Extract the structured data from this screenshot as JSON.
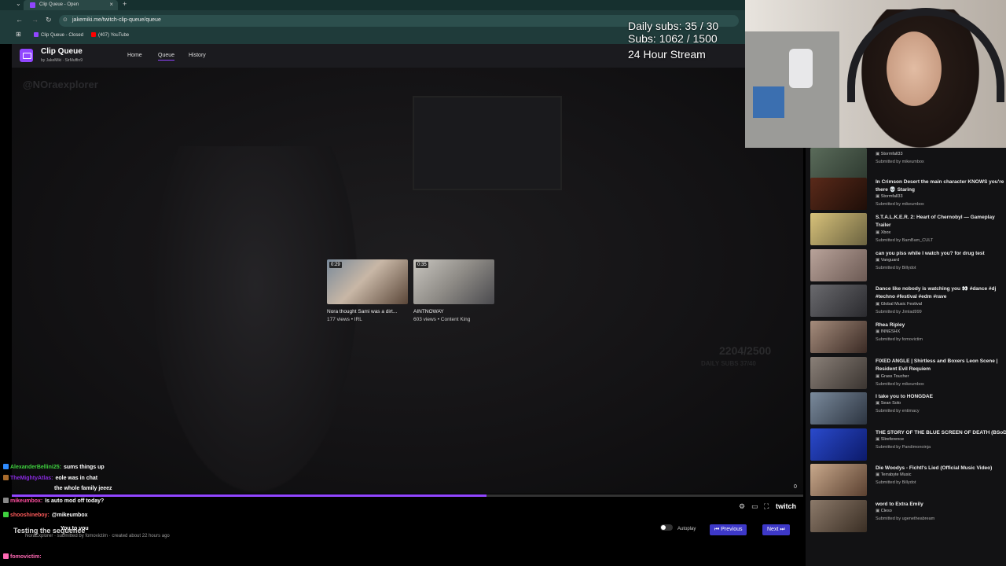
{
  "browser": {
    "tab_title": "Clip Queue - Open",
    "url": "jakemiki.me/twitch-clip-queue/queue",
    "bookmarks": [
      "Clip Queue - Closed",
      "(407) YouTube"
    ]
  },
  "app": {
    "title": "Clip Queue",
    "by": "by JakeMiki · SirMuffin9",
    "nav": [
      "Home",
      "Queue",
      "History"
    ],
    "active_nav": "Queue"
  },
  "overlay": {
    "daily_subs": "Daily subs: 35 / 30",
    "subs": "Subs: 1062 / 1500",
    "stream": "24 Hour Stream"
  },
  "player": {
    "watermark": "@NOraexplorer",
    "ghost_count": "2204/2500",
    "ghost_sub": "DAILY SUBS 37/40",
    "progress_fraction": 0.6,
    "time_label": "0",
    "brand": "twitch",
    "suggestions": [
      {
        "duration": "0:29",
        "title": "Nora thought Sami was a dirt...",
        "meta": "177 views • IRL"
      },
      {
        "duration": "0:35",
        "title": "AINTNOWAY",
        "meta": "603 views • Content King"
      }
    ]
  },
  "current_clip": {
    "title": "Testing the sequence",
    "meta": "NoraExplorer · submitted by fomovictim · created about 22 hours ago"
  },
  "controls": {
    "autoplay_label": "Autoplay",
    "previous_label": "Previous",
    "next_label": "Next"
  },
  "chat": [
    {
      "user": "AlexanderBellini25:",
      "msg": "sums things up",
      "color": "#3fd13f"
    },
    {
      "user": "TheMightyAtlas:",
      "msg": "eole was in chat",
      "color": "#8a2be2"
    },
    {
      "user": "",
      "msg": "the whole family jeeez",
      "color": "#1e90ff"
    },
    {
      "user": "mikeumbox:",
      "msg": "Is auto mod off today?",
      "color": "#ff4fa0"
    },
    {
      "user": "shooshineboy:",
      "msg": "@mikeumbox",
      "color": "#ff5a5a"
    },
    {
      "user": "",
      "msg": "You to you",
      "color": "#aaaaaa"
    },
    {
      "user": "fomovictim:",
      "msg": "",
      "color": "#ff69b4"
    }
  ],
  "queue": [
    {
      "title": "",
      "channel": "Stormfall33",
      "submitted": "Submitted by mikeumbox"
    },
    {
      "title": "In Crimson Desert the main character KNOWS you're there 💀 Staring",
      "channel": "Stormfall33",
      "submitted": "Submitted by mikeumbox"
    },
    {
      "title": "S.T.A.L.K.E.R. 2: Heart of Chernobyl — Gameplay Trailer",
      "channel": "Xbox",
      "submitted": "Submitted by BamBam_CULT"
    },
    {
      "title": "can you piss while I watch you? for drug test",
      "channel": "Vanguard",
      "submitted": "Submitted by Billydot"
    },
    {
      "title": "Dance like nobody is watching you 👀 #dance #dj #techno #festival #edm #rave",
      "channel": "Global Music Festival",
      "submitted": "Submitted by Jimlad999"
    },
    {
      "title": "Rhea Ripley",
      "channel": "INNESHX",
      "submitted": "Submitted by fomovictim"
    },
    {
      "title": "FIXED ANGLE | Shirtless and Boxers Leon Scene | Resident Evil Requiem",
      "channel": "Grass Toucher",
      "submitted": "Submitted by mikeumbox"
    },
    {
      "title": "I take you to HONGDAE",
      "channel": "Sean Solo",
      "submitted": "Submitted by entimacy"
    },
    {
      "title": "THE STORY OF THE BLUE SCREEN OF DEATH (BSoD)",
      "channel": "Slireference",
      "submitted": "Submitted by Pandimonoinja"
    },
    {
      "title": "Die Woodys - Fichtl's Lied (Official Music Video)",
      "channel": "Terrabyte Music",
      "submitted": "Submitted by Billydot"
    },
    {
      "title": "word to Extra Emily",
      "channel": "Cleso",
      "submitted": "Submitted by ugenetheabream"
    }
  ]
}
